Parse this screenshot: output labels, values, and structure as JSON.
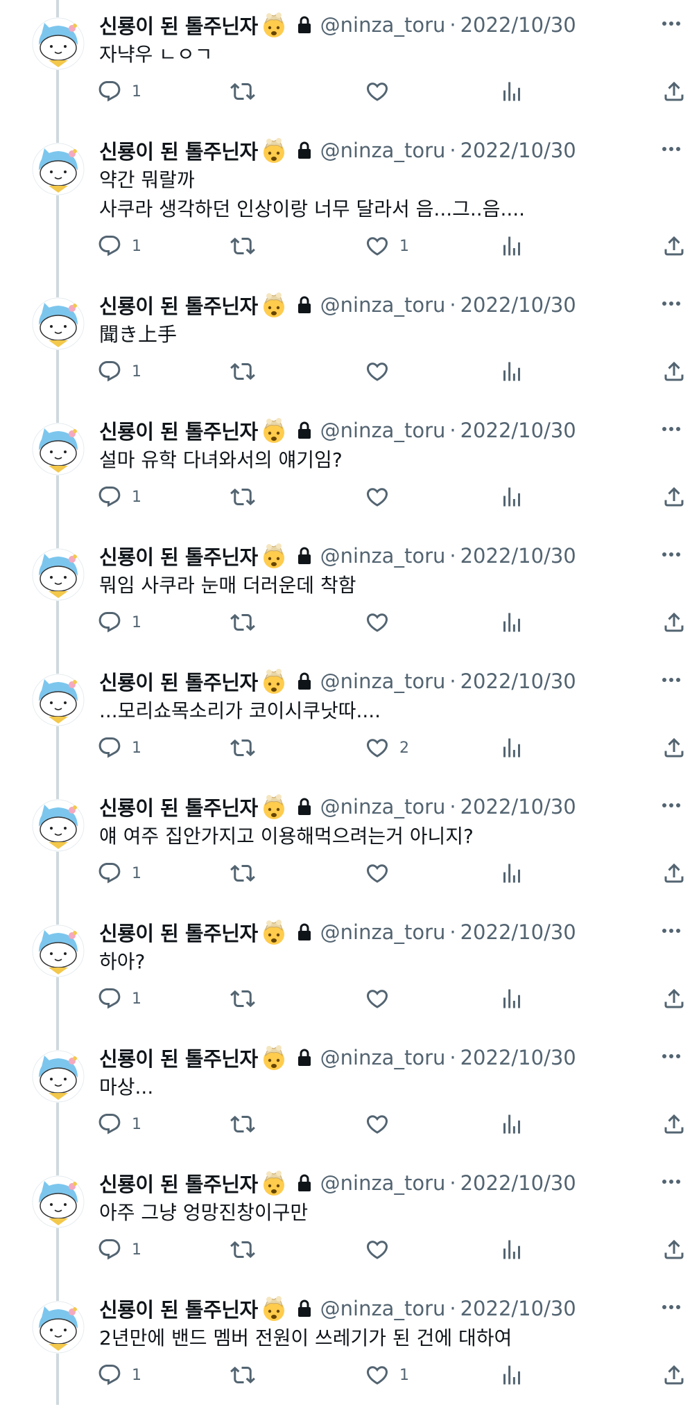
{
  "author": {
    "display_name": "신룡이 된 톨주닌자",
    "handle": "@ninza_toru",
    "separator": "·",
    "avatar_icon": "cat-avatar",
    "name_emoji": "exploding-head-emoji",
    "locked_icon": "lock-icon"
  },
  "tweets": [
    {
      "date": "2022/10/30",
      "text": "자냑우 ㄴㅇㄱ",
      "replies": "1",
      "retweets": "",
      "likes": "",
      "liked": false
    },
    {
      "date": "2022/10/30",
      "text": "약간 뭐랄까\n사쿠라 생각하던 인상이랑 너무 달라서 음...그..음....",
      "replies": "1",
      "retweets": "",
      "likes": "1",
      "liked": false
    },
    {
      "date": "2022/10/30",
      "text": "聞き上手",
      "replies": "1",
      "retweets": "",
      "likes": "",
      "liked": false
    },
    {
      "date": "2022/10/30",
      "text": "설마 유학 다녀와서의 얘기임?",
      "replies": "1",
      "retweets": "",
      "likes": "",
      "liked": false
    },
    {
      "date": "2022/10/30",
      "text": "뭐임 사쿠라 눈매 더러운데 착함",
      "replies": "1",
      "retweets": "",
      "likes": "",
      "liked": false
    },
    {
      "date": "2022/10/30",
      "text": "...모리쇼목소리가 코이시쿠낫따....",
      "replies": "1",
      "retweets": "",
      "likes": "2",
      "liked": false
    },
    {
      "date": "2022/10/30",
      "text": "얘 여주 집안가지고 이용해먹으려는거 아니지?",
      "replies": "1",
      "retweets": "",
      "likes": "",
      "liked": false
    },
    {
      "date": "2022/10/30",
      "text": "하아?",
      "replies": "1",
      "retweets": "",
      "likes": "",
      "liked": false
    },
    {
      "date": "2022/10/30",
      "text": "마상...",
      "replies": "1",
      "retweets": "",
      "likes": "",
      "liked": false
    },
    {
      "date": "2022/10/30",
      "text": "아주 그냥 엉망진창이구만",
      "replies": "1",
      "retweets": "",
      "likes": "",
      "liked": false
    },
    {
      "date": "2022/10/30",
      "text": "2년만에 밴드 멤버 전원이 쓰레기가 된 건에 대하여",
      "replies": "1",
      "retweets": "",
      "likes": "1",
      "liked": false
    }
  ],
  "colors": {
    "text": "#0f1419",
    "muted": "#536471",
    "thread_line": "#cfd9de",
    "avatar_blue": "#7cc6ee",
    "avatar_scarf": "#f3c84b"
  }
}
